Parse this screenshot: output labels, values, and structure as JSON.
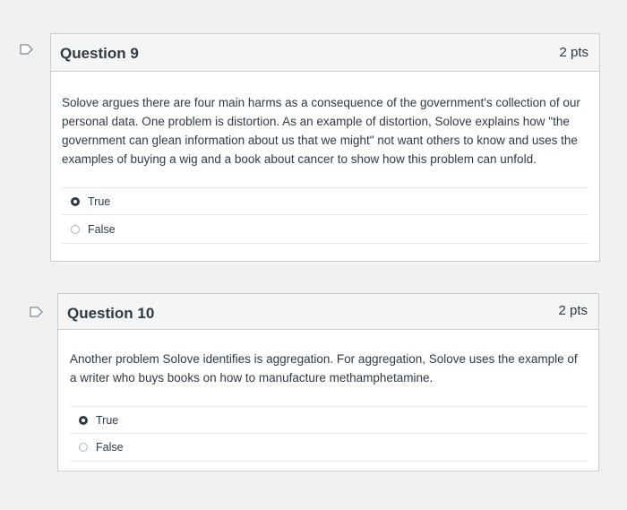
{
  "questions": [
    {
      "title": "Question 9",
      "points": "2 pts",
      "text": "Solove argues there are four main harms as a consequence of the government's collection of our personal data. One problem is distortion. As an example of distortion, Solove explains how \"the government can glean information about us that we might\" not want others to know and uses the examples of buying a wig and a book about cancer to show how this problem can unfold.",
      "answers": [
        {
          "label": "True",
          "selected": true
        },
        {
          "label": "False",
          "selected": false
        }
      ]
    },
    {
      "title": "Question 10",
      "points": "2 pts",
      "text": "Another problem Solove identifies is aggregation. For aggregation, Solove uses the example of a writer who buys books on how to manufacture methamphetamine.",
      "answers": [
        {
          "label": "True",
          "selected": true
        },
        {
          "label": "False",
          "selected": false
        }
      ]
    }
  ]
}
